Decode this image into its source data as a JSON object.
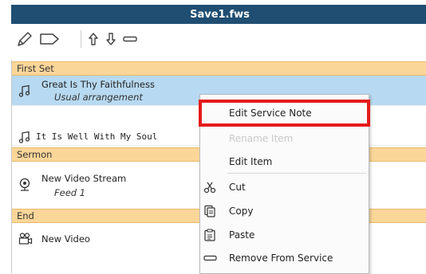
{
  "window": {
    "title": "Save1.fws"
  },
  "toolbar": {
    "buttons": [
      {
        "name": "edit-pencil-icon"
      },
      {
        "name": "label-tag-icon"
      },
      {
        "name": "move-up-arrow-icon"
      },
      {
        "name": "move-down-arrow-icon"
      },
      {
        "name": "remove-dash-icon"
      }
    ]
  },
  "list": {
    "sections": [
      {
        "label": "First Set"
      },
      {
        "label": "Sermon"
      },
      {
        "label": "End"
      }
    ],
    "items": [
      {
        "title": "Great Is Thy Faithfulness",
        "subtitle": "Usual arrangement",
        "icon": "music-note-icon"
      },
      {
        "title": "It Is Well With My Soul",
        "icon": "music-note-icon"
      },
      {
        "title": "New Video Stream",
        "subtitle": "Feed 1",
        "icon": "webcam-icon"
      },
      {
        "title": "New Video",
        "icon": "video-camera-icon"
      }
    ]
  },
  "context_menu": {
    "items": [
      {
        "label": "Edit Service Note",
        "highlighted": true
      },
      {
        "label": "Rename Item",
        "disabled": true
      },
      {
        "label": "Edit Item"
      },
      {
        "label": "Cut",
        "icon": "scissors-icon"
      },
      {
        "label": "Copy",
        "icon": "copy-icon"
      },
      {
        "label": "Paste",
        "icon": "paste-icon"
      },
      {
        "label": "Remove From Service",
        "icon": "remove-dash-icon"
      }
    ]
  },
  "colors": {
    "titlebar": "#1f4e72",
    "section": "#fbd699",
    "selected": "#b7d9f1",
    "highlight_border": "#e41b1b"
  }
}
